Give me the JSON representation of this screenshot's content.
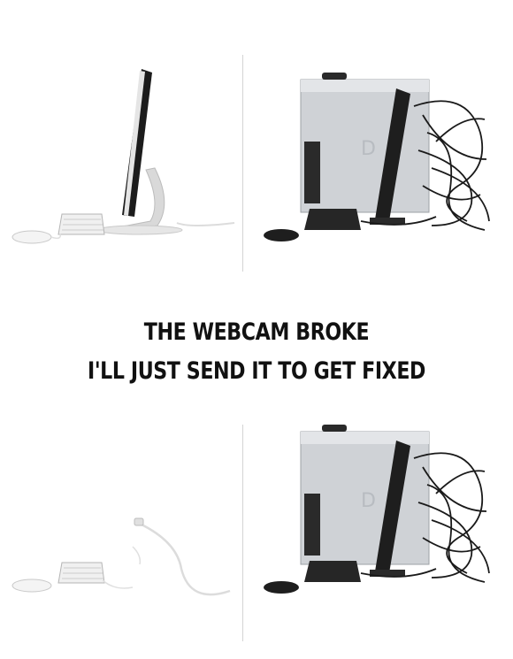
{
  "caption": {
    "line1": "THE WEBCAM BROKE",
    "line2": "I'LL JUST SEND IT TO GET FIXED"
  },
  "colors": {
    "background": "#ffffff",
    "text": "#111111",
    "imac_silver": "#d9d9d9",
    "dell_silver": "#cfd2d6",
    "cable_black": "#1a1a1a"
  },
  "panels": [
    {
      "id": "top-left",
      "scene": "imac-all-in-one"
    },
    {
      "id": "top-right",
      "scene": "dell-tower-with-cables"
    },
    {
      "id": "bottom-left",
      "scene": "imac-missing-with-dangling-cable"
    },
    {
      "id": "bottom-right",
      "scene": "dell-tower-with-cables"
    }
  ]
}
